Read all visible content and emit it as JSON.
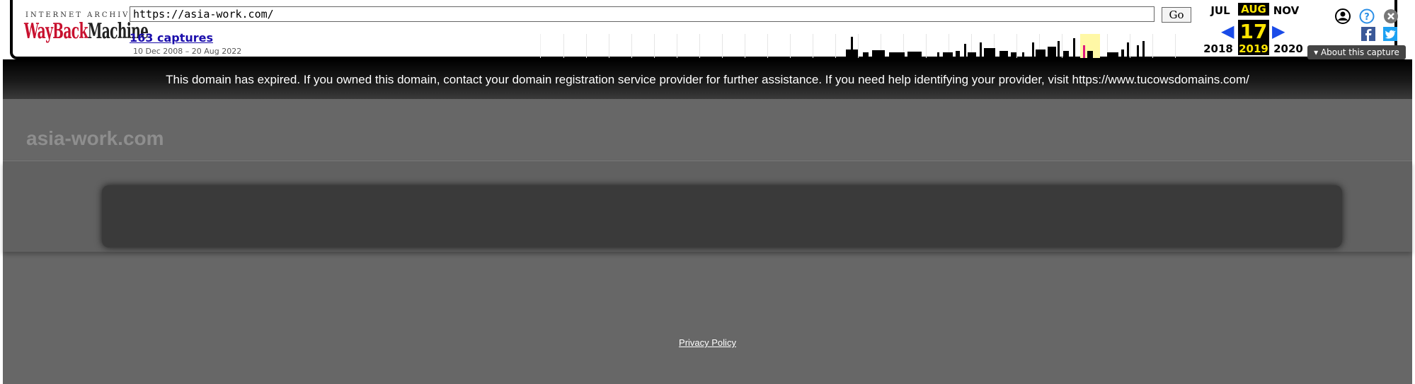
{
  "wayback": {
    "logo_top": "INTERNET ARCHIVE",
    "logo_way": "WayBack",
    "logo_machine": "Machine",
    "url": "https://asia-work.com/",
    "go_label": "Go",
    "captures": "163 captures",
    "date_range": "10 Dec 2008 – 20 Aug 2022",
    "calendar": {
      "prev_month": "JUL",
      "cur_month": "AUG",
      "next_month": "NOV",
      "day": "17",
      "prev_year": "2018",
      "cur_year": "2019",
      "next_year": "2020"
    },
    "about_label": "▾ About this capture",
    "accent": "#ffe600",
    "link_color": "#1a0dab"
  },
  "banner": {
    "message": "This domain has expired. If you owned this domain, contact your domain registration service provider for further assistance. If you need help identifying your provider, visit https://www.tucowsdomains.com/"
  },
  "page": {
    "site_title": "asia-work.com",
    "footer_link": "Privacy Policy",
    "background": "#676767"
  }
}
